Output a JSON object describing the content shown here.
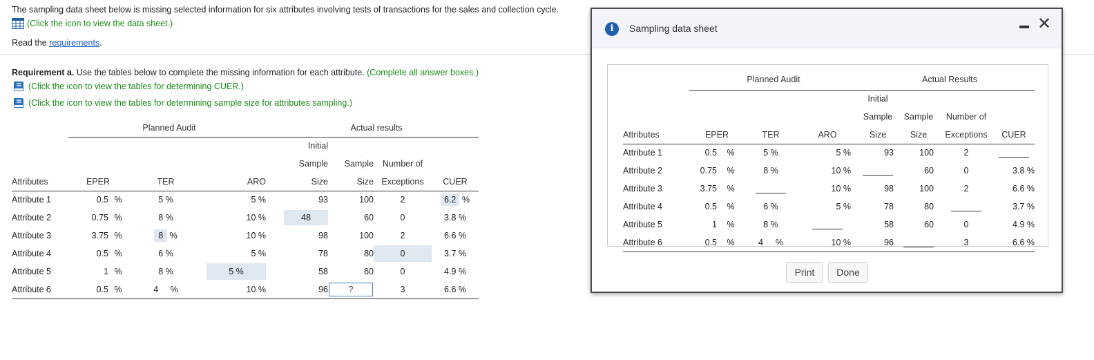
{
  "intro": {
    "text": "The sampling data sheet below is missing selected information for six attributes involving tests of transactions for the sales and collection cycle.",
    "sheet_link": "(Click the icon to view the data sheet.)",
    "read_prefix": "Read the ",
    "requirements_link": "requirements",
    "read_suffix": "."
  },
  "requirement": {
    "label": "Requirement a.",
    "text": " Use the tables below to complete the missing information for each attribute. ",
    "note": "(Complete all answer boxes.)",
    "cuer_link": "(Click the icon to view the tables for determining CUER.)",
    "sample_link": "(Click the icon to view the tables for determining sample size for attributes sampling.)"
  },
  "answer_table": {
    "group_planned": "Planned Audit",
    "group_actual": "Actual results",
    "h_initial": "Initial",
    "h_sample": "Sample",
    "h_sample2": "Sample",
    "h_numberof": "Number of",
    "columns": [
      "Attributes",
      "EPER",
      "TER",
      "ARO",
      "Size",
      "Size",
      "Exceptions",
      "CUER"
    ],
    "pct": "%",
    "rows": [
      {
        "attr": "Attribute 1",
        "eper": "0.5",
        "ter": "5 %",
        "aro": "5 %",
        "init": "93",
        "size": "100",
        "exc": "2",
        "cuer": "6.2"
      },
      {
        "attr": "Attribute 2",
        "eper": "0.75",
        "ter": "8 %",
        "aro": "10 %",
        "init": "48",
        "size": "60",
        "exc": "0",
        "cuer": "3.8 %"
      },
      {
        "attr": "Attribute 3",
        "eper": "3.75",
        "ter": "8",
        "aro": "10 %",
        "init": "98",
        "size": "100",
        "exc": "2",
        "cuer": "6.6 %"
      },
      {
        "attr": "Attribute 4",
        "eper": "0.5",
        "ter": "6 %",
        "aro": "5 %",
        "init": "78",
        "size": "80",
        "exc": "0",
        "cuer": "3.7 %"
      },
      {
        "attr": "Attribute 5",
        "eper": "1",
        "ter": "8 %",
        "aro": "5",
        "init": "58",
        "size": "60",
        "exc": "0",
        "cuer": "4.9 %"
      },
      {
        "attr": "Attribute 6",
        "eper": "0.5",
        "ter": "4",
        "aro": "10 %",
        "init": "96",
        "size": "?",
        "exc": "3",
        "cuer": "6.6 %"
      }
    ]
  },
  "modal": {
    "title": "Sampling data sheet",
    "group_planned": "Planned Audit",
    "group_actual": "Actual Results",
    "h_initial": "Initial",
    "h_sample": "Sample",
    "h_sample2": "Sample",
    "h_numberof": "Number of",
    "columns": [
      "Attributes",
      "EPER",
      "TER",
      "ARO",
      "Size",
      "Size",
      "Exceptions",
      "CUER"
    ],
    "pct": "%",
    "rows": [
      {
        "attr": "Attribute 1",
        "eper": "0.5",
        "ter": "5 %",
        "aro": "5 %",
        "init": "93",
        "size": "100",
        "exc": "2",
        "cuer": ""
      },
      {
        "attr": "Attribute 2",
        "eper": "0.75",
        "ter": "8 %",
        "aro": "10 %",
        "init": "",
        "size": "60",
        "exc": "0",
        "cuer": "3.8 %"
      },
      {
        "attr": "Attribute 3",
        "eper": "3.75",
        "ter": "",
        "aro": "10 %",
        "init": "98",
        "size": "100",
        "exc": "2",
        "cuer": "6.6 %"
      },
      {
        "attr": "Attribute 4",
        "eper": "0.5",
        "ter": "6 %",
        "aro": "5 %",
        "init": "78",
        "size": "80",
        "exc": "",
        "cuer": "3.7 %"
      },
      {
        "attr": "Attribute 5",
        "eper": "1",
        "ter": "8 %",
        "aro": "",
        "init": "58",
        "size": "60",
        "exc": "0",
        "cuer": "4.9 %"
      },
      {
        "attr": "Attribute 6",
        "eper": "0.5",
        "ter": "4",
        "aro": "10 %",
        "init": "96",
        "size": "",
        "exc": "3",
        "cuer": "6.6 %"
      }
    ],
    "print_label": "Print",
    "done_label": "Done"
  },
  "colors": {
    "accent": "#1f5fae",
    "green": "#1b8a1b",
    "shade": "#dfe7f1"
  },
  "icons": {
    "sheet": "table-grid-icon",
    "book": "book-icon",
    "info": "info-icon",
    "close": "close-icon",
    "minimize": "minimize-icon"
  }
}
